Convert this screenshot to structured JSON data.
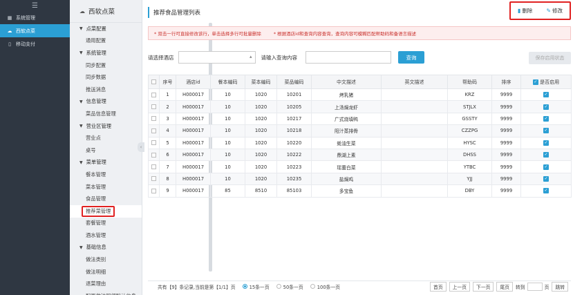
{
  "sidebar_main": {
    "items": [
      {
        "label": "系统管理",
        "icon": "grid-icon",
        "active": false
      },
      {
        "label": "西软点菜",
        "icon": "cloud-icon",
        "active": true
      },
      {
        "label": "移动支付",
        "icon": "mobile-icon",
        "active": false
      }
    ]
  },
  "sidebar_sub": {
    "header": "西软点菜",
    "groups": [
      {
        "label": "点菜配置",
        "items": [
          "通用配置"
        ]
      },
      {
        "label": "系统管理",
        "items": [
          "同步配置",
          "同步数据",
          "推送消息"
        ]
      },
      {
        "label": "信息管理",
        "items": [
          "菜品信息管理"
        ]
      },
      {
        "label": "营业区管理",
        "items": [
          "营业点",
          "桌号"
        ]
      },
      {
        "label": "菜单管理",
        "items": [
          "餐本管理",
          "菜本管理",
          "食品管理",
          "推荐菜管理",
          "套餐管理",
          "酒水管理"
        ]
      },
      {
        "label": "基础信息",
        "items": [
          "做法类别",
          "做法明细",
          "退菜理由",
          "配置做法明细默认信息"
        ]
      }
    ],
    "selected": "推荐菜管理"
  },
  "page": {
    "title": "推荐食品管理列表",
    "delete_label": "删除",
    "edit_label": "修改",
    "notice_1": "* 双击一行可直接修改该行，单击选择多行可批量删除",
    "notice_2": "* 根据酒店id和查询内容查询，查询内容可模糊匹配帮助码和备语言描述",
    "filter_hotel_label": "请选择酒店",
    "filter_query_label": "请输入查询内容",
    "query_button": "查询",
    "save_status_button": "保存启用状态"
  },
  "table": {
    "headers": [
      "序号",
      "酒店id",
      "餐本编码",
      "菜本编码",
      "菜品编码",
      "中文描述",
      "英文描述",
      "帮助码",
      "排序",
      "是否启用"
    ],
    "rows": [
      [
        "1",
        "H000017",
        "10",
        "1020",
        "10201",
        "烤乳猪",
        "",
        "KRZ",
        "9999"
      ],
      [
        "2",
        "H000017",
        "10",
        "1020",
        "10205",
        "上汤焗龙虾",
        "",
        "STJLX",
        "9999"
      ],
      [
        "3",
        "H000017",
        "10",
        "1020",
        "10217",
        "广式烧填鸭",
        "",
        "GSSTY",
        "9999"
      ],
      [
        "4",
        "H000017",
        "10",
        "1020",
        "10218",
        "阳汁蒸排骨",
        "",
        "CZZPG",
        "9999"
      ],
      [
        "5",
        "H000017",
        "10",
        "1020",
        "10220",
        "蚝油生菜",
        "",
        "HYSC",
        "9999"
      ],
      [
        "6",
        "H000017",
        "10",
        "1020",
        "10222",
        "鼎湖上素",
        "",
        "DHSS",
        "9999"
      ],
      [
        "7",
        "H000017",
        "10",
        "1020",
        "10223",
        "瑶蕾白菜",
        "",
        "YTBC",
        "9999"
      ],
      [
        "8",
        "H000017",
        "10",
        "1020",
        "10235",
        "盐焗鸡",
        "",
        "YJJ",
        "9999"
      ],
      [
        "9",
        "H000017",
        "85",
        "8510",
        "85103",
        "多宝鱼",
        "",
        "DBY",
        "9999"
      ]
    ]
  },
  "pager": {
    "info": "共有【9】条记录,当前是第【1/1】页",
    "size_15": "15条一页",
    "size_50": "50条一页",
    "size_100": "100条一页",
    "first": "首页",
    "prev": "上一页",
    "next": "下一页",
    "last": "尾页",
    "goto": "转到",
    "page_unit": "页",
    "jump": "跳转"
  },
  "colors": {
    "accent": "#2b9fd4",
    "sidebar": "#2f3742",
    "highlight": "#e02020"
  }
}
